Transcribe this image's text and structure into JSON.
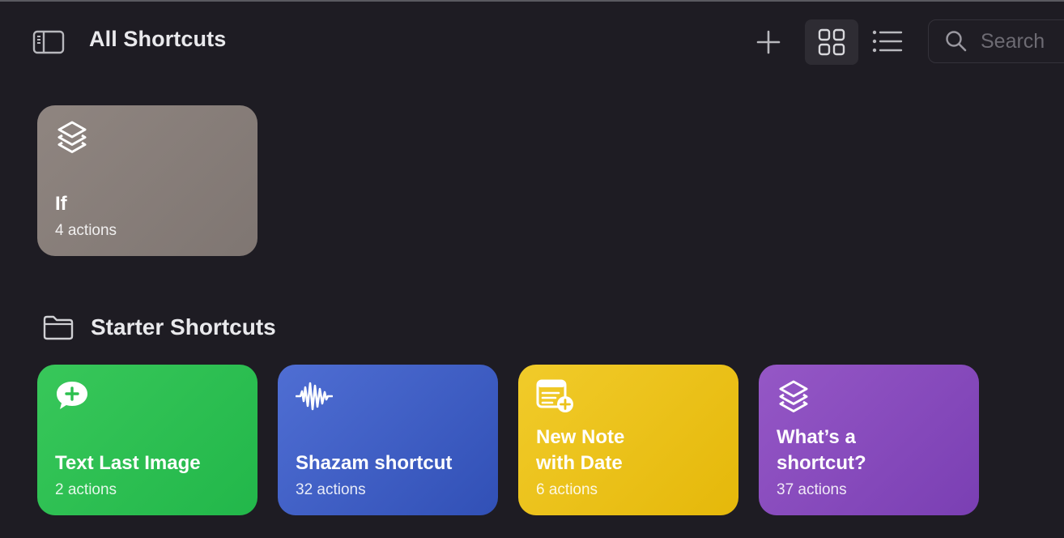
{
  "header": {
    "title": "All Shortcuts",
    "search_placeholder": "Search"
  },
  "colors": {
    "background": "#1e1c23",
    "card_if": "#877d79",
    "card_green": "#2cc04f",
    "card_blue": "#405fc4",
    "card_yellow": "#ebc21a",
    "card_purple": "#874abc"
  },
  "shortcuts": [
    {
      "name": "If",
      "actions": "4 actions",
      "icon": "layers-icon"
    }
  ],
  "starter_section": {
    "title": "Starter Shortcuts",
    "icon": "folder-icon",
    "items": [
      {
        "name": "Text Last Image",
        "actions": "2 actions",
        "icon": "message-plus-icon"
      },
      {
        "name": "Shazam shortcut",
        "actions": "32 actions",
        "icon": "waveform-icon"
      },
      {
        "name": "New Note\nwith Date",
        "actions": "6 actions",
        "icon": "note-plus-icon"
      },
      {
        "name": "What’s a\nshortcut?",
        "actions": "37 actions",
        "icon": "layers-icon"
      }
    ]
  }
}
